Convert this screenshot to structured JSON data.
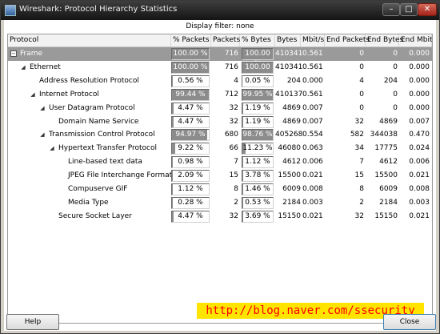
{
  "window": {
    "title": "Wireshark: Protocol Hierarchy Statistics",
    "minimize": "–",
    "maximize": "□",
    "close": "✕"
  },
  "filter": {
    "text": "Display filter: none"
  },
  "columns": [
    "Protocol",
    "% Packets",
    "Packets",
    "% Bytes",
    "Bytes",
    "Mbit/s",
    "End Packets",
    "End Bytes",
    "End Mbit/s"
  ],
  "rows": [
    {
      "depth": 0,
      "expander": "minus-box",
      "name": "Frame",
      "pct_packets": "100.00 %",
      "pct_packets_value": 100.0,
      "packets": "716",
      "pct_bytes": "100.00 %",
      "pct_bytes_value": 100.0,
      "bytes": "410341",
      "mbit": "0.561",
      "end_packets": "0",
      "end_bytes": "0",
      "end_mbit": "0.000",
      "selected": true
    },
    {
      "depth": 1,
      "expander": "arrow-down",
      "name": "Ethernet",
      "pct_packets": "100.00 %",
      "pct_packets_value": 100.0,
      "packets": "716",
      "pct_bytes": "100.00 %",
      "pct_bytes_value": 100.0,
      "bytes": "410341",
      "mbit": "0.561",
      "end_packets": "0",
      "end_bytes": "0",
      "end_mbit": "0.000"
    },
    {
      "depth": 2,
      "expander": "none",
      "name": "Address Resolution Protocol",
      "pct_packets": "0.56 %",
      "pct_packets_value": 0.56,
      "packets": "4",
      "pct_bytes": "0.05 %",
      "pct_bytes_value": 0.05,
      "bytes": "204",
      "mbit": "0.000",
      "end_packets": "4",
      "end_bytes": "204",
      "end_mbit": "0.000"
    },
    {
      "depth": 2,
      "expander": "arrow-down",
      "name": "Internet Protocol",
      "pct_packets": "99.44 %",
      "pct_packets_value": 99.44,
      "packets": "712",
      "pct_bytes": "99.95 %",
      "pct_bytes_value": 99.95,
      "bytes": "410137",
      "mbit": "0.561",
      "end_packets": "0",
      "end_bytes": "0",
      "end_mbit": "0.000"
    },
    {
      "depth": 3,
      "expander": "arrow-down",
      "name": "User Datagram Protocol",
      "pct_packets": "4.47 %",
      "pct_packets_value": 4.47,
      "packets": "32",
      "pct_bytes": "1.19 %",
      "pct_bytes_value": 1.19,
      "bytes": "4869",
      "mbit": "0.007",
      "end_packets": "0",
      "end_bytes": "0",
      "end_mbit": "0.000"
    },
    {
      "depth": 4,
      "expander": "none",
      "name": "Domain Name Service",
      "pct_packets": "4.47 %",
      "pct_packets_value": 4.47,
      "packets": "32",
      "pct_bytes": "1.19 %",
      "pct_bytes_value": 1.19,
      "bytes": "4869",
      "mbit": "0.007",
      "end_packets": "32",
      "end_bytes": "4869",
      "end_mbit": "0.007"
    },
    {
      "depth": 3,
      "expander": "arrow-down",
      "name": "Transmission Control Protocol",
      "pct_packets": "94.97 %",
      "pct_packets_value": 94.97,
      "packets": "680",
      "pct_bytes": "98.76 %",
      "pct_bytes_value": 98.76,
      "bytes": "405268",
      "mbit": "0.554",
      "end_packets": "582",
      "end_bytes": "344038",
      "end_mbit": "0.470"
    },
    {
      "depth": 4,
      "expander": "arrow-down",
      "name": "Hypertext Transfer Protocol",
      "pct_packets": "9.22 %",
      "pct_packets_value": 9.22,
      "packets": "66",
      "pct_bytes": "11.23 %",
      "pct_bytes_value": 11.23,
      "bytes": "46080",
      "mbit": "0.063",
      "end_packets": "34",
      "end_bytes": "17775",
      "end_mbit": "0.024"
    },
    {
      "depth": 5,
      "expander": "none",
      "name": "Line-based text data",
      "pct_packets": "0.98 %",
      "pct_packets_value": 0.98,
      "packets": "7",
      "pct_bytes": "1.12 %",
      "pct_bytes_value": 1.12,
      "bytes": "4612",
      "mbit": "0.006",
      "end_packets": "7",
      "end_bytes": "4612",
      "end_mbit": "0.006"
    },
    {
      "depth": 5,
      "expander": "none",
      "name": "JPEG File Interchange Format",
      "pct_packets": "2.09 %",
      "pct_packets_value": 2.09,
      "packets": "15",
      "pct_bytes": "3.78 %",
      "pct_bytes_value": 3.78,
      "bytes": "15500",
      "mbit": "0.021",
      "end_packets": "15",
      "end_bytes": "15500",
      "end_mbit": "0.021"
    },
    {
      "depth": 5,
      "expander": "none",
      "name": "Compuserve GIF",
      "pct_packets": "1.12 %",
      "pct_packets_value": 1.12,
      "packets": "8",
      "pct_bytes": "1.46 %",
      "pct_bytes_value": 1.46,
      "bytes": "6009",
      "mbit": "0.008",
      "end_packets": "8",
      "end_bytes": "6009",
      "end_mbit": "0.008"
    },
    {
      "depth": 5,
      "expander": "none",
      "name": "Media Type",
      "pct_packets": "0.28 %",
      "pct_packets_value": 0.28,
      "packets": "2",
      "pct_bytes": "0.53 %",
      "pct_bytes_value": 0.53,
      "bytes": "2184",
      "mbit": "0.003",
      "end_packets": "2",
      "end_bytes": "2184",
      "end_mbit": "0.003"
    },
    {
      "depth": 4,
      "expander": "none",
      "name": "Secure Socket Layer",
      "pct_packets": "4.47 %",
      "pct_packets_value": 4.47,
      "packets": "32",
      "pct_bytes": "3.69 %",
      "pct_bytes_value": 3.69,
      "bytes": "15150",
      "mbit": "0.021",
      "end_packets": "32",
      "end_bytes": "15150",
      "end_mbit": "0.021"
    }
  ],
  "buttons": {
    "help": "Help",
    "close": "Close"
  },
  "watermark": "http://blog.naver.com/ssecurity",
  "colors": {
    "selected_row": "#9a9a9a",
    "bar_fill": "#8c8c8c",
    "watermark_bg": "#ffe400",
    "watermark_text": "#ff0000"
  }
}
